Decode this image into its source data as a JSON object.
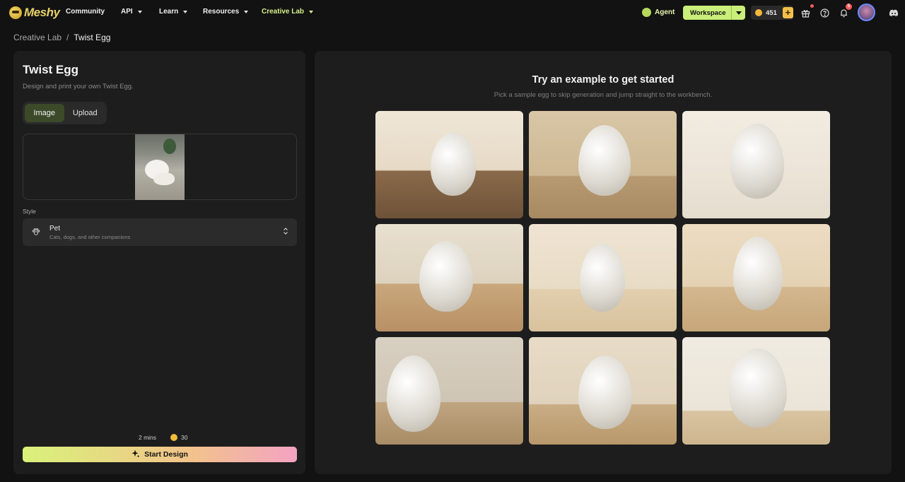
{
  "nav": {
    "logo": "Meshy",
    "items": [
      {
        "label": "Community",
        "dropdown": false
      },
      {
        "label": "API",
        "dropdown": true
      },
      {
        "label": "Learn",
        "dropdown": true
      },
      {
        "label": "Resources",
        "dropdown": true
      },
      {
        "label": "Creative Lab",
        "dropdown": true
      }
    ],
    "agent_label": "Agent",
    "workspace_label": "Workspace",
    "credits": "451",
    "notification_count": "5"
  },
  "breadcrumb": {
    "parent": "Creative Lab",
    "separator": "/",
    "current": "Twist Egg"
  },
  "left": {
    "title": "Twist Egg",
    "subtitle": "Design and print your own Twist Egg.",
    "tabs": [
      {
        "label": "Image",
        "selected": true
      },
      {
        "label": "Upload",
        "selected": false
      }
    ],
    "style_label": "Style",
    "style_name": "Pet",
    "style_desc": "Cats, dogs, and other companions",
    "time": "2 mins",
    "cost": "30",
    "start_label": "Start Design"
  },
  "right": {
    "title": "Try an example to get started",
    "subtitle": "Pick a sample egg to skip generation and jump straight to the workbench."
  },
  "colors": {
    "accent": "#c9ee7a",
    "active_nav": "#d7f08a",
    "coin": "#f2b93b"
  }
}
